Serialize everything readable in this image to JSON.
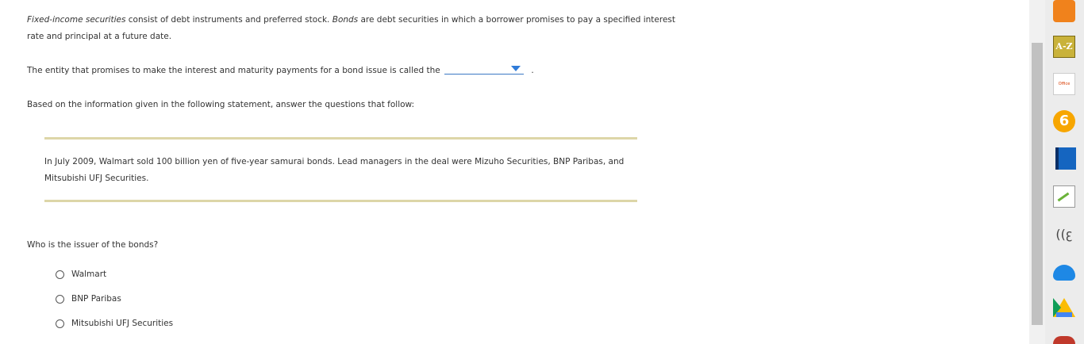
{
  "paragraph1": {
    "term1": "Fixed-income securities",
    "text1": " consist of debt instruments and preferred stock. ",
    "term2": "Bonds",
    "text2": " are debt securities in which a borrower promises to pay a specified interest rate and principal at a future date."
  },
  "question1": {
    "prefix": "The entity that promises to make the interest and maturity payments for a bond issue is called the",
    "dropdown_value": "",
    "suffix": "."
  },
  "instruction": "Based on the information given in the following statement, answer the questions that follow:",
  "statement": {
    "text": "In July 2009, Walmart sold 100 billion yen of five-year samurai bonds. Lead managers in the deal were Mizuho Securities, BNP Paribas, and Mitsubishi UFJ Securities."
  },
  "question2": {
    "text": "Who is the issuer of the bonds?",
    "options": [
      "Walmart",
      "BNP Paribas",
      "Mitsubishi UFJ Securities"
    ]
  },
  "toolbar": {
    "icons": [
      "rss-icon",
      "a-z-dictionary-icon",
      "office-icon",
      "six-icon",
      "book-icon",
      "note-icon",
      "voice-icon",
      "onedrive-icon",
      "google-drive-icon",
      "extension-icon"
    ],
    "az_label": "A-Z",
    "office_label": "Office",
    "six_label": "6",
    "voice_label": "((ꜫ"
  },
  "colors": {
    "rule": "#ddd6a8",
    "dropdown_accent": "#2f7bd8",
    "text": "#333333"
  }
}
